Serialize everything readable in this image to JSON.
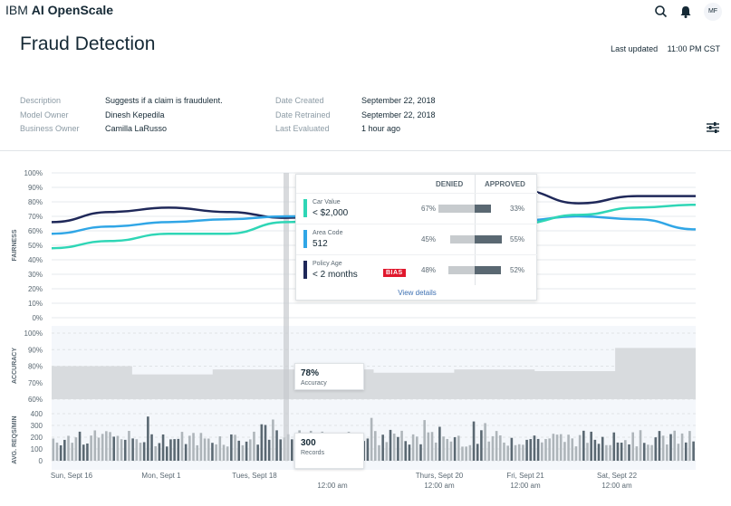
{
  "app": {
    "brand_light": "IBM",
    "brand_bold": "AI OpenScale",
    "user_initials": "MF"
  },
  "icons": {
    "search": "search-icon",
    "notifications": "bell-icon",
    "filter": "sliders-icon"
  },
  "header": {
    "title": "Fraud Detection",
    "last_updated_label": "Last updated",
    "last_updated_value": "11:00 PM CST"
  },
  "meta": {
    "left": [
      {
        "label": "Description",
        "value": "Suggests if a claim is fraudulent."
      },
      {
        "label": "Model Owner",
        "value": "Dinesh Kepedila"
      },
      {
        "label": "Business Owner",
        "value": "Camilla LaRusso"
      }
    ],
    "right": [
      {
        "label": "Date Created",
        "value": "September 22, 2018"
      },
      {
        "label": "Date Retrained",
        "value": "September 22, 2018"
      },
      {
        "label": "Last Evaluated",
        "value": "1 hour ago"
      }
    ]
  },
  "popup": {
    "denied_label": "DENIED",
    "approved_label": "APPROVED",
    "rows": [
      {
        "name": "Car Value",
        "value": "< $2,000",
        "color": "#2fd6b6",
        "denied": "67%",
        "approved": "33%",
        "denied_frac": 0.67,
        "approved_frac": 0.33,
        "bias": ""
      },
      {
        "name": "Area Code",
        "value": "512",
        "color": "#30a6e6",
        "denied": "45%",
        "approved": "55%",
        "denied_frac": 0.45,
        "approved_frac": 0.55,
        "bias": ""
      },
      {
        "name": "Policy Age",
        "value": "< 2 months",
        "color": "#1f2859",
        "denied": "48%",
        "approved": "52%",
        "denied_frac": 0.48,
        "approved_frac": 0.52,
        "bias": "BIAS"
      }
    ],
    "view_details": "View details"
  },
  "accuracy_box": {
    "value": "78%",
    "label": "Accuracy"
  },
  "records_box": {
    "value": "300",
    "label": "Records"
  },
  "chart_data": {
    "type": "line",
    "panels": {
      "fairness": {
        "ylabel": "FAIRNESS",
        "ylim": [
          0,
          100
        ],
        "yticks": [
          "100%",
          "90%",
          "80%",
          "70%",
          "60%",
          "50%",
          "40%",
          "30%",
          "20%",
          "10%",
          "0%"
        ],
        "series": [
          {
            "color": "#1f2859",
            "values": [
              66,
              73,
              76,
              73,
              69,
              71,
              72,
              78,
              88,
              79,
              84,
              84
            ]
          },
          {
            "color": "#30a6e6",
            "values": [
              58,
              63,
              66,
              68,
              70,
              70,
              71,
              70,
              67,
              70,
              68,
              61
            ]
          },
          {
            "color": "#2fd6b6",
            "values": [
              48,
              53,
              58,
              58,
              66,
              69,
              70,
              69,
              65,
              71,
              76,
              78
            ]
          }
        ]
      },
      "accuracy": {
        "ylabel": "ACCURACY",
        "ylim": [
          60,
          100
        ],
        "yticks": [
          "100%",
          "90%",
          "80%",
          "70%",
          "60%"
        ],
        "step_values": [
          80,
          75,
          78,
          78,
          76,
          78,
          77,
          91
        ]
      },
      "volume": {
        "ylabel": "AVG. REQS/MIN",
        "ylim": [
          0,
          400
        ],
        "yticks": [
          "400",
          "300",
          "200",
          "100",
          "0"
        ]
      }
    },
    "x_labels": [
      {
        "day": "Sun, Sept 16",
        "time": ""
      },
      {
        "day": "Mon, Sept 1",
        "time": ""
      },
      {
        "day": "Tues, Sept 18",
        "time": ""
      },
      {
        "day": "",
        "time": "12:00 am"
      },
      {
        "day": "Thurs, Sept 20",
        "time": "12:00 am"
      },
      {
        "day": "Fri, Sept 21",
        "time": "12:00 am"
      },
      {
        "day": "Sat, Sept 22",
        "time": "12:00 am"
      }
    ],
    "grid": true,
    "legend": "none"
  }
}
